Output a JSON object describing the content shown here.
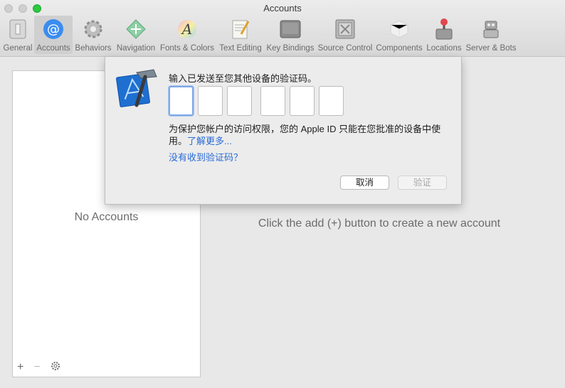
{
  "window": {
    "title": "Accounts"
  },
  "toolbar": {
    "items": [
      {
        "label": "General",
        "icon": "general-icon"
      },
      {
        "label": "Accounts",
        "icon": "at-sign-icon"
      },
      {
        "label": "Behaviors",
        "icon": "gear-icon"
      },
      {
        "label": "Navigation",
        "icon": "navigation-icon"
      },
      {
        "label": "Fonts & Colors",
        "icon": "font-icon"
      },
      {
        "label": "Text Editing",
        "icon": "text-editing-icon"
      },
      {
        "label": "Key Bindings",
        "icon": "key-icon"
      },
      {
        "label": "Source Control",
        "icon": "source-control-icon"
      },
      {
        "label": "Components",
        "icon": "components-icon"
      },
      {
        "label": "Locations",
        "icon": "joystick-icon"
      },
      {
        "label": "Server & Bots",
        "icon": "robot-icon"
      }
    ]
  },
  "left_pane": {
    "empty_label": "No Accounts"
  },
  "main": {
    "hint": "Click the add (+) button to create a new account"
  },
  "dialog": {
    "prompt": "输入已发送至您其他设备的验证码。",
    "info": "为保护您帐户的访问权限，您的 Apple ID 只能在您批准的设备中使用。",
    "learn_more": "了解更多...",
    "no_code": "没有收到验证码？",
    "cancel": "取消",
    "verify": "验证"
  },
  "pane_tools": {
    "add": "+",
    "remove": "−"
  },
  "colors": {
    "accent": "#2a6bd6",
    "zoom": "#2bc840"
  }
}
